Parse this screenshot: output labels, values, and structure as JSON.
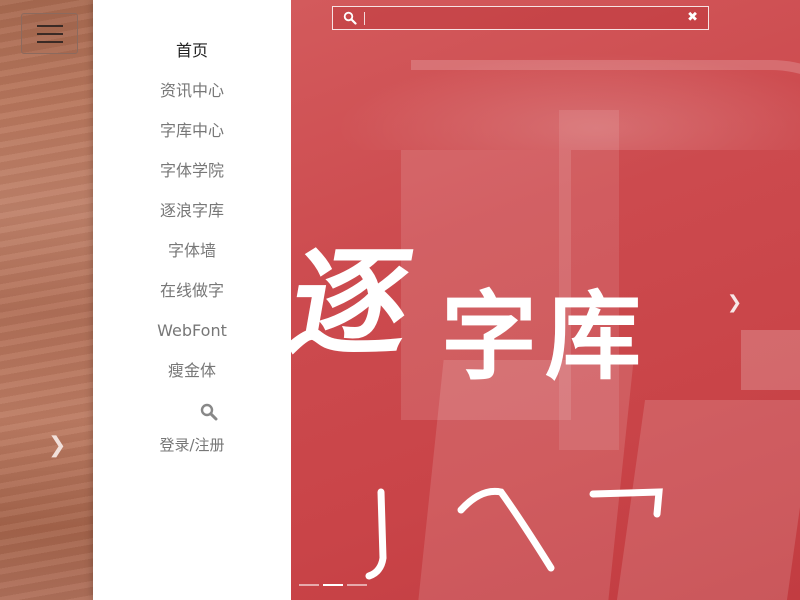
{
  "nav": {
    "items": [
      {
        "label": "首页",
        "active": true
      },
      {
        "label": "资讯中心"
      },
      {
        "label": "字库中心"
      },
      {
        "label": "字体学院"
      },
      {
        "label": "逐浪字库"
      },
      {
        "label": "字体墙"
      },
      {
        "label": "在线做字"
      },
      {
        "label": "WebFont"
      },
      {
        "label": "瘦金体"
      }
    ],
    "login_label": "登录/注册",
    "search_icon": "search-icon",
    "menu_icon": "hamburger-icon"
  },
  "search": {
    "value": "",
    "placeholder": "",
    "clear_icon": "close-icon"
  },
  "hero": {
    "glyph": "逐",
    "title": "字库",
    "next_icon": "chevron-right-icon",
    "slide_count": 3,
    "active_slide": 2
  },
  "colors": {
    "hero_red": "#c94448",
    "drawer_bg": "#ffffff",
    "nav_text": "#777777",
    "nav_active": "#222222"
  }
}
